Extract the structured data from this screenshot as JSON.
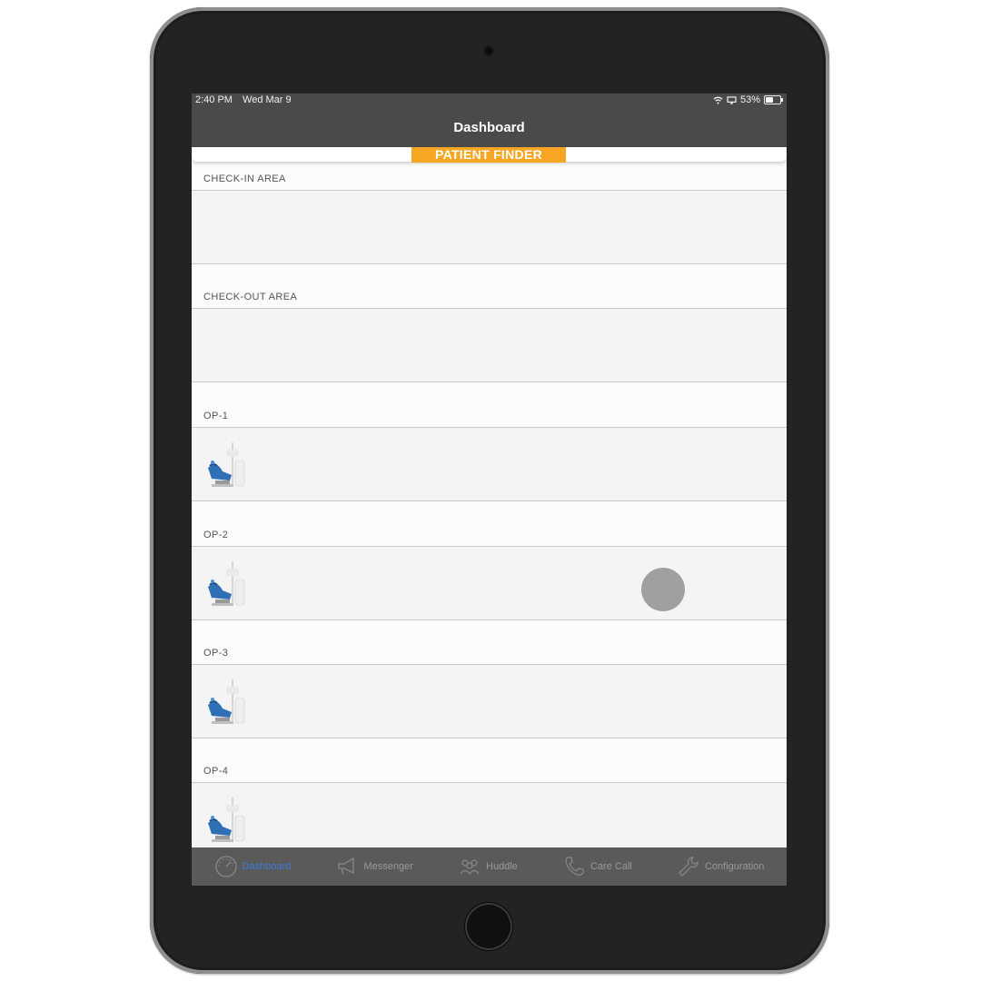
{
  "status_bar": {
    "time": "2:40 PM",
    "date": "Wed Mar 9",
    "battery": "53%"
  },
  "nav": {
    "title": "Dashboard"
  },
  "patient_finder": {
    "label": "PATIENT FINDER"
  },
  "sections": [
    {
      "label": "CHECK-IN AREA",
      "icon": null
    },
    {
      "label": "CHECK-OUT AREA",
      "icon": null
    },
    {
      "label": "OP-1",
      "icon": "dental-chair-icon"
    },
    {
      "label": "OP-2",
      "icon": "dental-chair-icon"
    },
    {
      "label": "OP-3",
      "icon": "dental-chair-icon"
    },
    {
      "label": "OP-4",
      "icon": "dental-chair-icon"
    }
  ],
  "tabs": [
    {
      "label": "Dashboard",
      "icon": "speedometer-icon",
      "active": true
    },
    {
      "label": "Messenger",
      "icon": "megaphone-icon",
      "active": false
    },
    {
      "label": "Huddle",
      "icon": "group-icon",
      "active": false
    },
    {
      "label": "Care Call",
      "icon": "phone-icon",
      "active": false
    },
    {
      "label": "Configuration",
      "icon": "wrench-icon",
      "active": false
    }
  ],
  "colors": {
    "accent": "#f6a623",
    "active_tab": "#3b7bd9",
    "nav_bg": "#4a4a4a"
  }
}
